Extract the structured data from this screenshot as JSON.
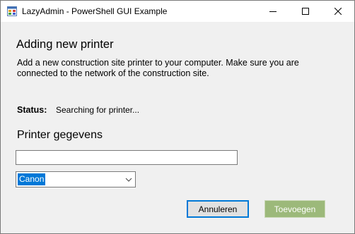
{
  "window": {
    "title": "LazyAdmin - PowerShell GUI Example",
    "app_icon": "windows-forms-app-icon",
    "controls": [
      "minimize-icon",
      "maximize-icon",
      "close-icon"
    ]
  },
  "main": {
    "heading": "Adding new printer",
    "description": "Add a new construction site printer to your computer. Make sure you are connected to the network of the construction site.",
    "status_label": "Status:",
    "status_value": "Searching for printer...",
    "subheading": "Printer gegevens"
  },
  "form": {
    "printer_name_value": "",
    "brand_selected": "Canon"
  },
  "buttons": {
    "cancel_label": "Annuleren",
    "add_label": "Toevoegen"
  },
  "colors": {
    "accent": "#0078d7",
    "add_button": "#9cb97a"
  }
}
